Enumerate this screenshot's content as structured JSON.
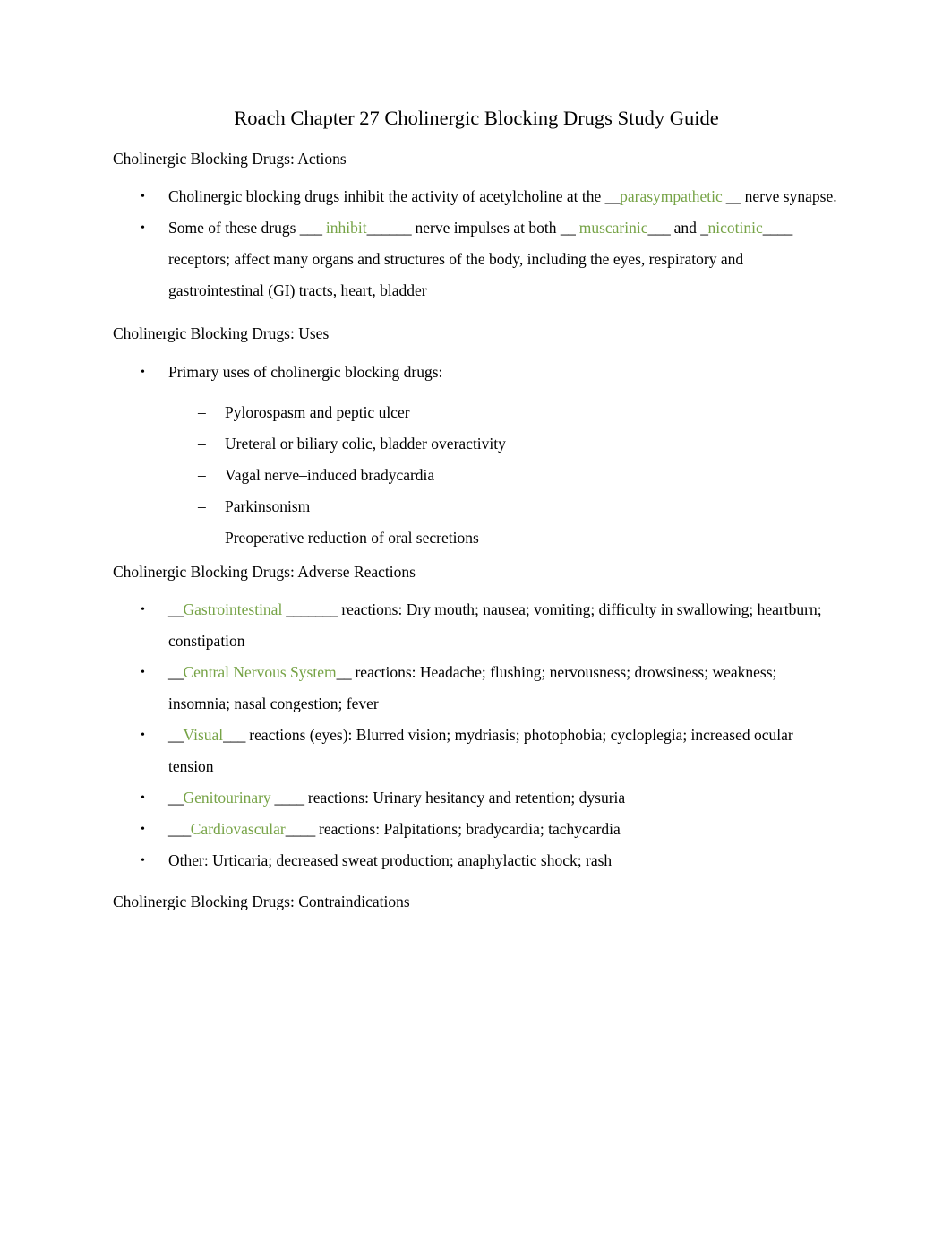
{
  "document": {
    "title": "Roach Chapter 27 Cholinergic Blocking Drugs Study Guide",
    "accent_color": "#76a346",
    "text_color": "#000000",
    "background_color": "#ffffff"
  },
  "sections": [
    {
      "heading": "Cholinergic Blocking Drugs: Actions",
      "bullets": [
        {
          "bullet_glyph": "•",
          "parts": [
            {
              "type": "text",
              "value": "Cholinergic blocking drugs inhibit the activity of acetylcholine at the "
            },
            {
              "type": "blank",
              "value": "__"
            },
            {
              "type": "answer",
              "value": "parasympathetic"
            },
            {
              "type": "blank",
              "value": " __"
            },
            {
              "type": "text",
              "value": " nerve synapse."
            }
          ]
        },
        {
          "bullet_glyph": "•",
          "parts": [
            {
              "type": "text",
              "value": "Some of these drugs "
            },
            {
              "type": "blank",
              "value": "___"
            },
            {
              "type": "answer",
              "value": " inhibit"
            },
            {
              "type": "blank",
              "value": "______"
            },
            {
              "type": "text",
              "value": " nerve impulses at both "
            },
            {
              "type": "blank",
              "value": "__"
            },
            {
              "type": "answer",
              "value": " muscarinic"
            },
            {
              "type": "blank",
              "value": "___"
            },
            {
              "type": "text",
              "value": " and "
            },
            {
              "type": "blank",
              "value": "_"
            },
            {
              "type": "answer",
              "value": "nicotinic"
            },
            {
              "type": "blank",
              "value": "____"
            },
            {
              "type": "text",
              "value": " receptors; affect many organs and structures of the body, including the eyes, respiratory and gastrointestinal (GI) tracts, heart, bladder"
            }
          ]
        }
      ]
    },
    {
      "heading": "Cholinergic Blocking Drugs: Uses",
      "bullets": [
        {
          "bullet_glyph": "•",
          "parts": [
            {
              "type": "text",
              "value": "Primary uses of cholinergic blocking drugs:"
            }
          ],
          "subitems": [
            {
              "dash_glyph": "–",
              "text": "Pylorospasm and peptic ulcer"
            },
            {
              "dash_glyph": "–",
              "text": "Ureteral or biliary colic, bladder overactivity"
            },
            {
              "dash_glyph": "–",
              "text": "Vagal nerve–induced bradycardia"
            },
            {
              "dash_glyph": "–",
              "text": "Parkinsonism"
            },
            {
              "dash_glyph": "–",
              "text": "Preoperative reduction of oral secretions"
            }
          ]
        }
      ]
    },
    {
      "heading": "Cholinergic Blocking Drugs: Adverse Reactions",
      "bullets": [
        {
          "bullet_glyph": "•",
          "parts": [
            {
              "type": "blank",
              "value": "__"
            },
            {
              "type": "answer",
              "value": "Gastrointestinal"
            },
            {
              "type": "blank",
              "value": " _______"
            },
            {
              "type": "text",
              "value": " reactions: Dry mouth; nausea; vomiting; difficulty in swallowing; heartburn; constipation"
            }
          ]
        },
        {
          "bullet_glyph": "•",
          "parts": [
            {
              "type": "blank",
              "value": "__"
            },
            {
              "type": "answer",
              "value": "Central Nervous System"
            },
            {
              "type": "blank",
              "value": "__"
            },
            {
              "type": "text",
              "value": " reactions: Headache; flushing; nervousness; drowsiness; weakness; insomnia; nasal congestion; fever"
            }
          ]
        },
        {
          "bullet_glyph": "•",
          "parts": [
            {
              "type": "blank",
              "value": "__"
            },
            {
              "type": "answer",
              "value": "Visual"
            },
            {
              "type": "blank",
              "value": "___"
            },
            {
              "type": "text",
              "value": " reactions (eyes): Blurred vision; mydriasis; photophobia; cycloplegia; increased ocular tension"
            }
          ]
        },
        {
          "bullet_glyph": "•",
          "parts": [
            {
              "type": "blank",
              "value": "__"
            },
            {
              "type": "answer",
              "value": "Genitourinary"
            },
            {
              "type": "blank",
              "value": " ____"
            },
            {
              "type": "text",
              "value": " reactions: Urinary hesitancy and retention; dysuria"
            }
          ]
        },
        {
          "bullet_glyph": "•",
          "parts": [
            {
              "type": "blank",
              "value": "___"
            },
            {
              "type": "answer",
              "value": "Cardiovascular"
            },
            {
              "type": "blank",
              "value": "____"
            },
            {
              "type": "text",
              "value": " reactions: Palpitations; bradycardia; tachycardia"
            }
          ]
        },
        {
          "bullet_glyph": "•",
          "parts": [
            {
              "type": "text",
              "value": "Other: Urticaria; decreased sweat production; anaphylactic shock; rash"
            }
          ]
        }
      ]
    },
    {
      "heading": "Cholinergic Blocking Drugs: Contraindications",
      "bullets": []
    }
  ]
}
